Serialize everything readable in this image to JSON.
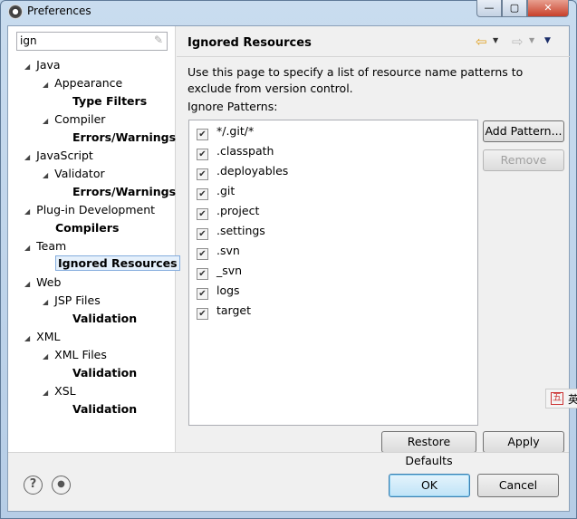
{
  "window": {
    "title": "Preferences",
    "controls": [
      "minimize",
      "maximize",
      "close"
    ]
  },
  "search": {
    "value": "ign"
  },
  "tree": [
    {
      "label": "Java",
      "level": 0,
      "expanded": true
    },
    {
      "label": "Appearance",
      "level": 1,
      "expanded": true
    },
    {
      "label": "Type Filters",
      "level": 2
    },
    {
      "label": "Compiler",
      "level": 1,
      "expanded": true
    },
    {
      "label": "Errors/Warnings",
      "level": 2
    },
    {
      "label": "JavaScript",
      "level": 0,
      "expanded": true
    },
    {
      "label": "Validator",
      "level": 1,
      "expanded": true
    },
    {
      "label": "Errors/Warnings",
      "level": 2
    },
    {
      "label": "Plug-in Development",
      "level": 0,
      "expanded": true
    },
    {
      "label": "Compilers",
      "level": 1
    },
    {
      "label": "Team",
      "level": 0,
      "expanded": true
    },
    {
      "label": "Ignored Resources",
      "level": 1,
      "selected": true
    },
    {
      "label": "Web",
      "level": 0,
      "expanded": true
    },
    {
      "label": "JSP Files",
      "level": 1,
      "expanded": true
    },
    {
      "label": "Validation",
      "level": 2
    },
    {
      "label": "XML",
      "level": 0,
      "expanded": true
    },
    {
      "label": "XML Files",
      "level": 1,
      "expanded": true
    },
    {
      "label": "Validation",
      "level": 2
    },
    {
      "label": "XSL",
      "level": 1,
      "expanded": true
    },
    {
      "label": "Validation",
      "level": 2
    }
  ],
  "page": {
    "title": "Ignored Resources",
    "description": "Use this page to specify a list of resource name patterns to exclude from version control.",
    "patterns_label": "Ignore Patterns:",
    "patterns": [
      {
        "name": "*/.git/*",
        "checked": true
      },
      {
        "name": ".classpath",
        "checked": true
      },
      {
        "name": ".deployables",
        "checked": true
      },
      {
        "name": ".git",
        "checked": true
      },
      {
        "name": ".project",
        "checked": true
      },
      {
        "name": ".settings",
        "checked": true
      },
      {
        "name": ".svn",
        "checked": true
      },
      {
        "name": "_svn",
        "checked": true
      },
      {
        "name": "logs",
        "checked": true
      },
      {
        "name": "target",
        "checked": true
      }
    ],
    "add_pattern": "Add Pattern...",
    "remove": "Remove",
    "restore_defaults": "Restore Defaults",
    "apply": "Apply"
  },
  "footer": {
    "ok": "OK",
    "cancel": "Cancel",
    "help": "?"
  },
  "ime": {
    "label": "五",
    "text": "英"
  }
}
